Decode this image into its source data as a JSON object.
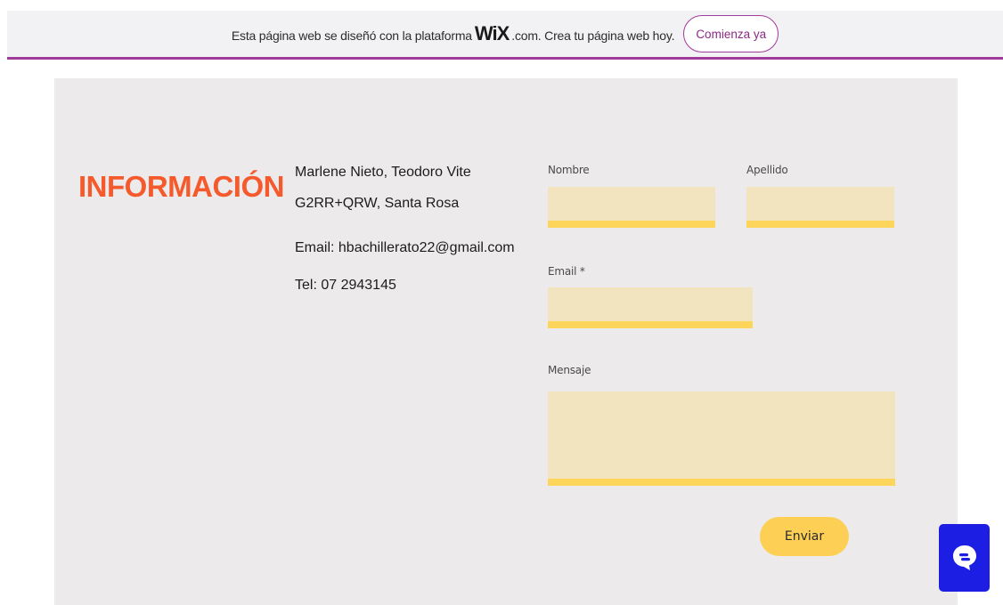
{
  "banner": {
    "text_before": "Esta página web se diseñó con la plataforma",
    "logo": "WiX",
    "text_after": ".com. Crea tu página web hoy.",
    "cta_label": "Comienza ya"
  },
  "info": {
    "heading": "INFORMACIÓN",
    "names": "Marlene Nieto, Teodoro Vite",
    "address": "G2RR+QRW, Santa Rosa",
    "email": "Email: hbachillerato22@gmail.com",
    "phone": "Tel: 07 2943145"
  },
  "form": {
    "first_name_label": "Nombre",
    "last_name_label": "Apellido",
    "email_label": "Email *",
    "message_label": "Mensaje",
    "first_name_value": "",
    "last_name_value": "",
    "email_value": "",
    "message_value": "",
    "submit_label": "Enviar"
  },
  "chat": {
    "icon": "chat-bubble-icon"
  },
  "colors": {
    "heading": "#f55a2d",
    "field_fill": "#f3e4c0",
    "field_underline": "#fdd55a",
    "button": "#fdd055",
    "banner_accent": "#a03a9b",
    "chat_widget": "#1c1ee3"
  }
}
